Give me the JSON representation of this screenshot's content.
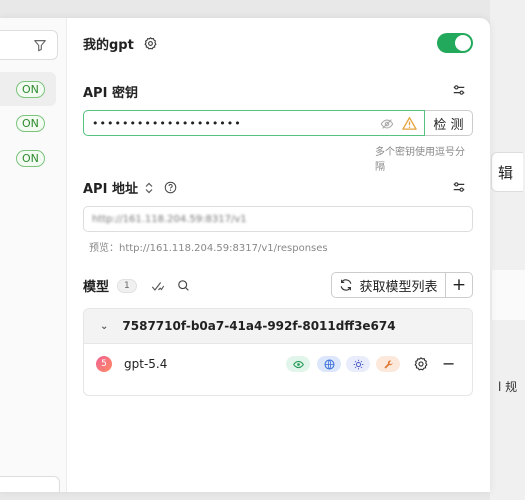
{
  "background": {
    "edit_button_label": "辑",
    "rule_text": "l 规"
  },
  "sidebar": {
    "items": [
      {
        "status": "ON",
        "active": true
      },
      {
        "status": "ON",
        "active": false
      },
      {
        "status": "ON",
        "active": false
      }
    ]
  },
  "provider": {
    "name": "我的gpt",
    "enabled": true,
    "accent_color": "#22a95b"
  },
  "api_key": {
    "label": "API 密钥",
    "value": "••••••••••••••••••••",
    "check_button": "检 测",
    "hint": "多个密钥使用逗号分隔"
  },
  "api_url": {
    "label": "API 地址",
    "value": "http://161.118.204.59:8317/v1",
    "preview": "预览：http://161.118.204.59:8317/v1/responses"
  },
  "models": {
    "label": "模型",
    "count": "1",
    "fetch_button": "获取模型列表",
    "group": {
      "name": "7587710f-b0a7-41a4-992f-8011dff3e674",
      "items": [
        {
          "badge": "5",
          "name": "gpt-5.4",
          "capabilities": [
            "vision",
            "web",
            "reasoning",
            "tool"
          ]
        }
      ]
    }
  }
}
